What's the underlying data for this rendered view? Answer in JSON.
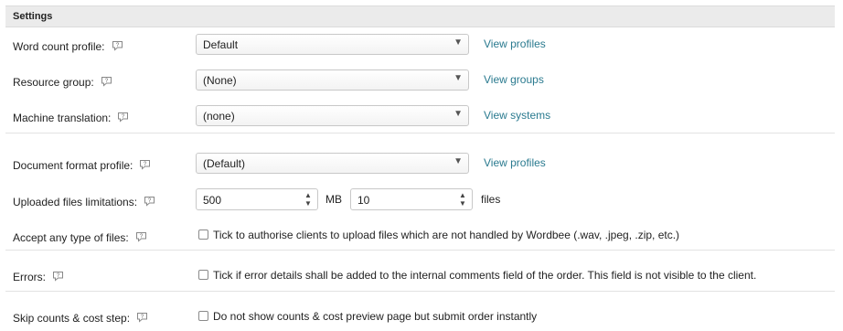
{
  "section": {
    "title": "Settings"
  },
  "rows": {
    "word_count": {
      "label": "Word count profile:",
      "value": "Default",
      "link": "View profiles"
    },
    "resource_group": {
      "label": "Resource group:",
      "value": "(None)",
      "link": "View groups"
    },
    "machine_translation": {
      "label": "Machine translation:",
      "value": "(none)",
      "link": "View systems"
    },
    "document_format": {
      "label": "Document format profile:",
      "value": "(Default)",
      "link": "View profiles"
    },
    "uploaded_files": {
      "label": "Uploaded files limitations:",
      "size_value": "500",
      "size_unit": "MB",
      "count_value": "10",
      "count_unit": "files"
    },
    "accept_files": {
      "label": "Accept any type of files:",
      "checkbox_label": "Tick to authorise clients to upload files which are not handled by Wordbee (.wav, .jpeg, .zip, etc.)",
      "checked": false
    },
    "errors": {
      "label": "Errors:",
      "checkbox_label": "Tick if error details shall be added to the internal comments field of the order. This field is not visible to the client.",
      "checked": false
    },
    "skip_counts": {
      "label": "Skip counts & cost step:",
      "checkbox_label": "Do not show counts & cost preview page but submit order instantly",
      "checked": false
    }
  },
  "icons": {
    "help": "speech-bubble-help-icon",
    "dropdown": "chevron-down-icon",
    "spinner": "up-down-arrows-icon"
  },
  "colors": {
    "link": "#2a7a8f",
    "header_bg": "#ebebeb"
  }
}
